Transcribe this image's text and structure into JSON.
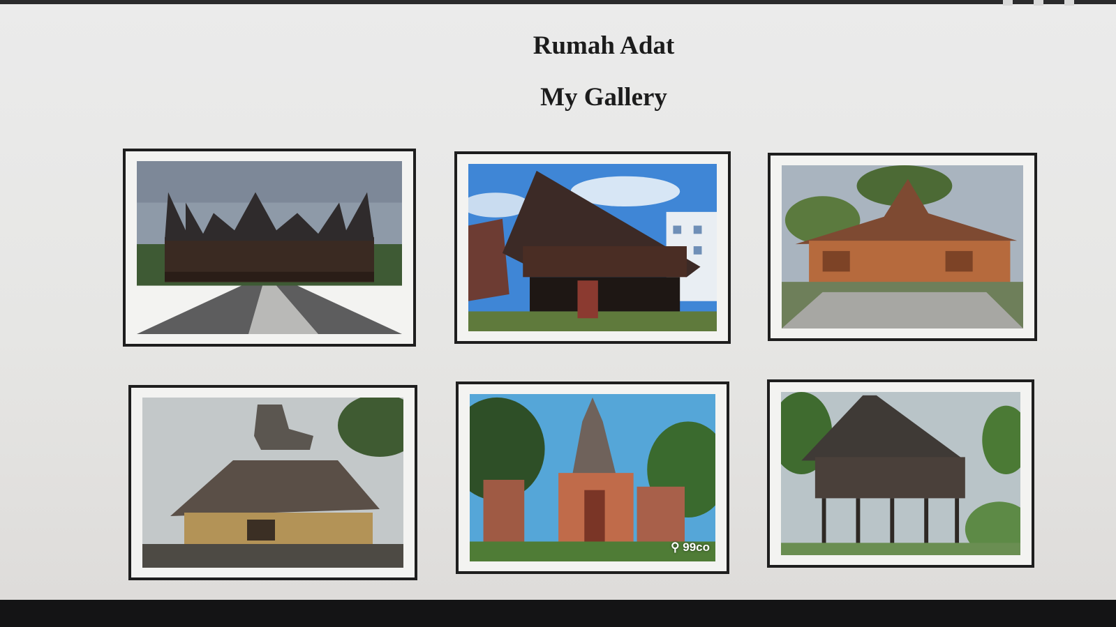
{
  "header": {
    "title": "Rumah Adat",
    "subtitle": "My Gallery"
  },
  "gallery": {
    "items": [
      {
        "subject": "rumah-gadang"
      },
      {
        "subject": "rumah-aceh"
      },
      {
        "subject": "rumah-limas"
      },
      {
        "subject": "rumah-bolon"
      },
      {
        "subject": "bali-gate",
        "watermark": "⚲ 99co"
      },
      {
        "subject": "stilt-house"
      }
    ]
  }
}
